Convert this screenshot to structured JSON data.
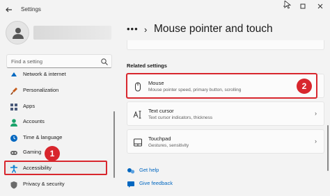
{
  "window": {
    "app_title": "Settings",
    "back_icon": "back-arrow-icon",
    "controls": [
      "minimize-icon",
      "maximize-icon",
      "close-icon"
    ]
  },
  "sidebar": {
    "search_placeholder": "Find a setting",
    "items": [
      {
        "label": "Network & internet",
        "icon": "network-icon",
        "color": "#0067c0"
      },
      {
        "label": "Personalization",
        "icon": "brush-icon",
        "color": "#c45a1a"
      },
      {
        "label": "Apps",
        "icon": "apps-icon",
        "color": "#4a5a7a"
      },
      {
        "label": "Accounts",
        "icon": "person-icon",
        "color": "#1aa36b"
      },
      {
        "label": "Time & language",
        "icon": "globe-clock-icon",
        "color": "#0067c0"
      },
      {
        "label": "Gaming",
        "icon": "controller-icon",
        "color": "#6b6b6b"
      },
      {
        "label": "Accessibility",
        "icon": "accessibility-icon",
        "color": "#0a7fd1"
      },
      {
        "label": "Privacy & security",
        "icon": "shield-icon",
        "color": "#6b6b6b"
      }
    ]
  },
  "annotations": {
    "badge_1": "1",
    "badge_2": "2",
    "color": "#d8262d"
  },
  "main": {
    "breadcrumb_dots": "•••",
    "breadcrumb_sep": "›",
    "title": "Mouse pointer and touch",
    "related_heading": "Related settings",
    "cards": [
      {
        "title": "Mouse",
        "subtitle": "Mouse pointer speed, primary button, scrolling",
        "icon": "mouse-icon"
      },
      {
        "title": "Text cursor",
        "subtitle": "Text cursor indicators, thickness",
        "icon": "text-cursor-icon"
      },
      {
        "title": "Touchpad",
        "subtitle": "Gestures, sensitivity",
        "icon": "touchpad-icon"
      }
    ],
    "card_arrow": "›",
    "links": [
      {
        "label": "Get help",
        "icon": "help-icon"
      },
      {
        "label": "Give feedback",
        "icon": "feedback-icon"
      }
    ]
  }
}
